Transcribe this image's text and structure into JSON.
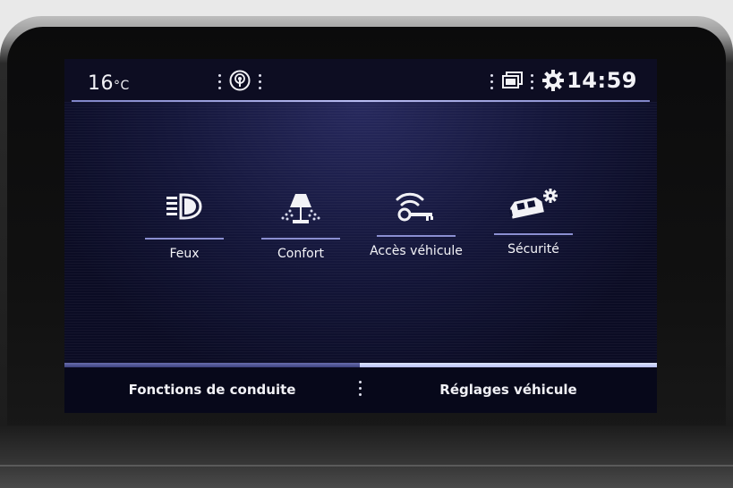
{
  "statusbar": {
    "temperature_value": "16",
    "temperature_unit": "°C",
    "time": "14:59",
    "icons": [
      "wireless-source-icon",
      "screens-icon",
      "settings-gear-icon"
    ]
  },
  "menu": {
    "items": [
      {
        "label": "Feux",
        "icon": "headlight-icon"
      },
      {
        "label": "Confort",
        "icon": "lamp-icon"
      },
      {
        "label": "Accès véhicule",
        "icon": "key-signal-icon"
      },
      {
        "label": "Sécurité",
        "icon": "car-gear-icon"
      }
    ]
  },
  "tabs": {
    "left_label": "Fonctions de conduite",
    "right_label": "Réglages véhicule",
    "active": "Réglages véhicule"
  },
  "colors": {
    "screen_bg": "#0a0a1e",
    "accent_line": "#8b8fd1",
    "active_tab": "#c9d0ff",
    "text": "#f4f4f8"
  }
}
